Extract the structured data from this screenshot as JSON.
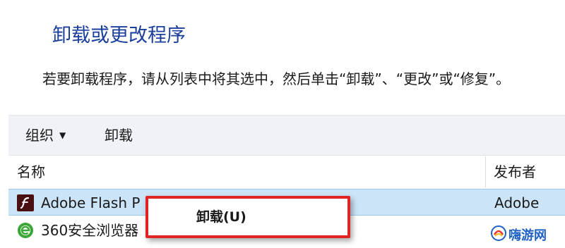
{
  "header": {
    "title": "卸载或更改程序",
    "instruction": "若要卸载程序，请从列表中将其选中，然后单击“卸载”、“更改”或“修复”。"
  },
  "toolbar": {
    "organize_label": "组织",
    "uninstall_label": "卸载"
  },
  "columns": {
    "name": "名称",
    "publisher": "发布者"
  },
  "programs": [
    {
      "name": "Adobe Flash P",
      "publisher": "Adobe",
      "icon": "adobe-flash-icon",
      "selected": true
    },
    {
      "name": "360安全浏览器",
      "publisher": "",
      "icon": "360-browser-icon",
      "selected": false
    }
  ],
  "context_menu": {
    "items": [
      "卸载(U)"
    ]
  },
  "watermark": {
    "text": "嗨游网"
  },
  "colors": {
    "title": "#1b3f9c",
    "selection": "#cce4f7",
    "highlight_border": "#e02424",
    "toolbar_bg": "#f0f2f7"
  }
}
